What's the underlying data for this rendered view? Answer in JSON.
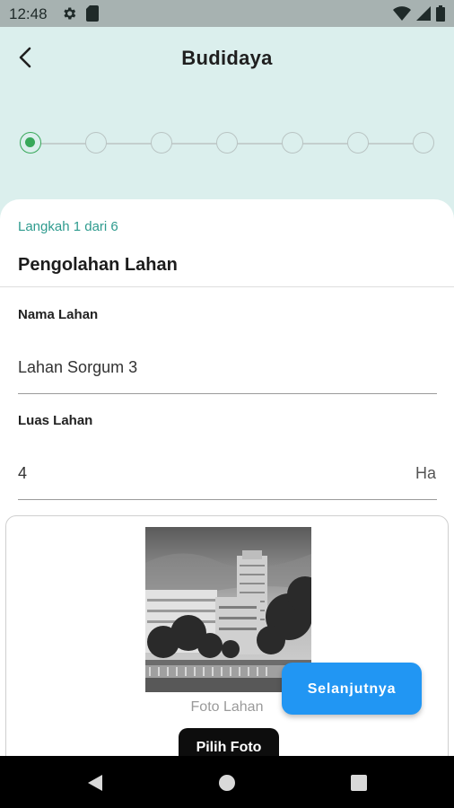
{
  "status_bar": {
    "time": "12:48",
    "left_icons": [
      "gear-icon",
      "sim-card-icon"
    ],
    "right_icons": [
      "wifi-icon",
      "signal-icon",
      "battery-icon"
    ]
  },
  "app_bar": {
    "title": "Budidaya",
    "back_icon": "chevron-left-icon"
  },
  "stepper": {
    "total_steps": 7,
    "active_index": 0,
    "active_color": "#38a85a"
  },
  "form": {
    "step_caption": "Langkah 1 dari 6",
    "section_title": "Pengolahan Lahan",
    "fields": [
      {
        "label": "Nama Lahan",
        "value": "Lahan Sorgum 3",
        "suffix": ""
      },
      {
        "label": "Luas Lahan",
        "value": "4",
        "suffix": "Ha"
      }
    ],
    "photo": {
      "caption": "Foto Lahan",
      "pick_button_label": "Pilih Foto"
    }
  },
  "next_button": {
    "label": "Selanjutnya",
    "color": "#2196f3"
  },
  "nav_bar": {
    "buttons": [
      "back-triangle-icon",
      "home-circle-icon",
      "recents-square-icon"
    ]
  },
  "theme": {
    "header_background": "#dbefed",
    "accent_text": "#2e9b8e"
  }
}
